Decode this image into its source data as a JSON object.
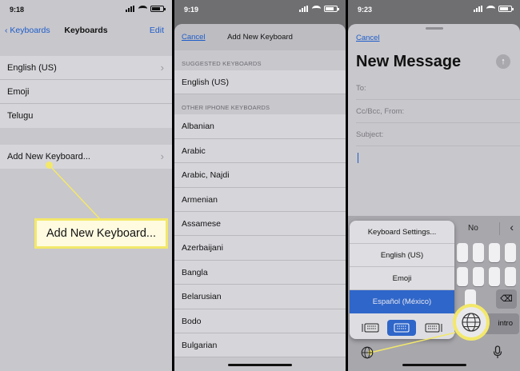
{
  "panel1": {
    "status_time": "9:18",
    "nav": {
      "back": "Keyboards",
      "title": "Keyboards",
      "edit": "Edit"
    },
    "keyboards": [
      "English (US)",
      "Emoji",
      "Telugu"
    ],
    "add_new": "Add New Keyboard...",
    "callout": "Add New Keyboard...",
    "highlight_color": "#f3e86a"
  },
  "panel2": {
    "status_time": "9:19",
    "cancel": "Cancel",
    "title": "Add New Keyboard",
    "suggested_header": "SUGGESTED KEYBOARDS",
    "suggested": [
      "English (US)"
    ],
    "other_header": "OTHER IPHONE KEYBOARDS",
    "other": [
      "Albanian",
      "Arabic",
      "Arabic, Najdi",
      "Armenian",
      "Assamese",
      "Azerbaijani",
      "Bangla",
      "Belarusian",
      "Bodo",
      "Bulgarian"
    ]
  },
  "panel3": {
    "status_time": "9:23",
    "cancel": "Cancel",
    "title": "New Message",
    "fields": {
      "to": "To:",
      "cc": "Cc/Bcc, From:",
      "subject": "Subject:"
    },
    "suggestion": "No",
    "menu": {
      "settings": "Keyboard Settings...",
      "items": [
        "English (US)",
        "Emoji",
        "Español (México)"
      ],
      "selected_index": 2
    },
    "intro_key": "intro",
    "accent_color": "#2f66c9"
  }
}
